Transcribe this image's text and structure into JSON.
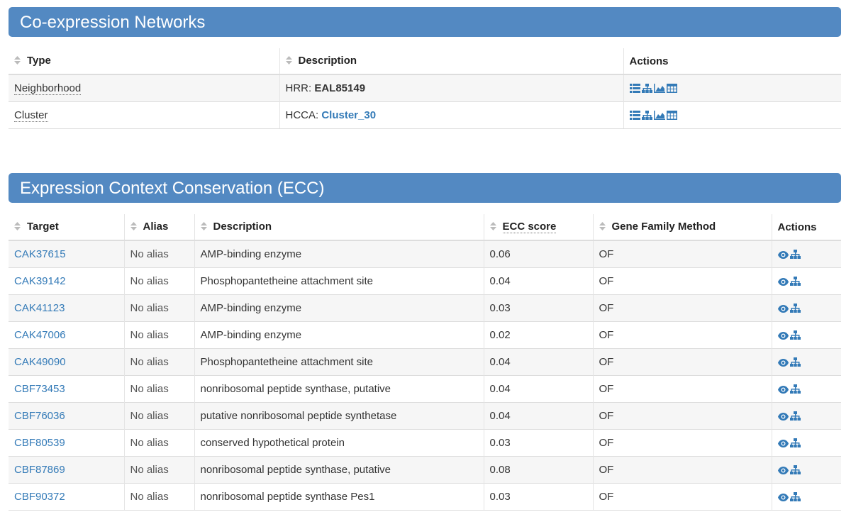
{
  "networks": {
    "title": "Co-expression Networks",
    "headers": {
      "type": "Type",
      "description": "Description",
      "actions": "Actions"
    },
    "rows": [
      {
        "type": "Neighborhood",
        "prefix": "HRR:",
        "value": "EAL85149",
        "icons": [
          "list-icon",
          "sitemap-icon",
          "area-chart-icon",
          "table-icon"
        ]
      },
      {
        "type": "Cluster",
        "prefix": "HCCA:",
        "value": "Cluster_30",
        "icons": [
          "list-icon",
          "sitemap-icon",
          "area-chart-icon",
          "table-icon"
        ]
      }
    ]
  },
  "ecc": {
    "title": "Expression Context Conservation (ECC)",
    "headers": {
      "target": "Target",
      "alias": "Alias",
      "description": "Description",
      "score": "ECC score",
      "method": "Gene Family Method",
      "actions": "Actions"
    },
    "rows": [
      {
        "target": "CAK37615",
        "alias": "No alias",
        "description": "AMP-binding enzyme",
        "score": "0.06",
        "method": "OF"
      },
      {
        "target": "CAK39142",
        "alias": "No alias",
        "description": "Phosphopantetheine attachment site",
        "score": "0.04",
        "method": "OF"
      },
      {
        "target": "CAK41123",
        "alias": "No alias",
        "description": "AMP-binding enzyme",
        "score": "0.03",
        "method": "OF"
      },
      {
        "target": "CAK47006",
        "alias": "No alias",
        "description": "AMP-binding enzyme",
        "score": "0.02",
        "method": "OF"
      },
      {
        "target": "CAK49090",
        "alias": "No alias",
        "description": "Phosphopantetheine attachment site",
        "score": "0.04",
        "method": "OF"
      },
      {
        "target": "CBF73453",
        "alias": "No alias",
        "description": "nonribosomal peptide synthase, putative",
        "score": "0.04",
        "method": "OF"
      },
      {
        "target": "CBF76036",
        "alias": "No alias",
        "description": "putative nonribosomal peptide synthetase",
        "score": "0.04",
        "method": "OF"
      },
      {
        "target": "CBF80539",
        "alias": "No alias",
        "description": "conserved hypothetical protein",
        "score": "0.03",
        "method": "OF"
      },
      {
        "target": "CBF87869",
        "alias": "No alias",
        "description": "nonribosomal peptide synthase, putative",
        "score": "0.08",
        "method": "OF"
      },
      {
        "target": "CBF90372",
        "alias": "No alias",
        "description": "nonribosomal peptide synthase Pes1",
        "score": "0.03",
        "method": "OF"
      }
    ],
    "row_icons": [
      "eye-icon",
      "sitemap-icon"
    ]
  },
  "colors": {
    "header_bg": "#5389c2",
    "link": "#337ab7",
    "stripe": "#f6f6f6"
  }
}
